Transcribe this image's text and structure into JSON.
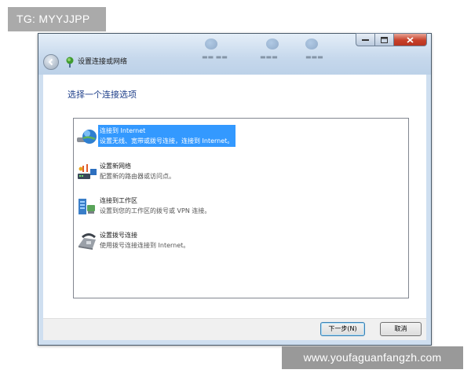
{
  "overlays": {
    "top_left_tag": "TG: MYYJJPP",
    "bottom_right_watermark": "www.youfaguanfangzh.com"
  },
  "window": {
    "title": "设置连接或网络",
    "back_icon": "back-arrow-icon",
    "title_icon": "network-setup-icon",
    "controls": {
      "minimize": "minimize-icon",
      "maximize": "maximize-icon",
      "close": "close-icon"
    }
  },
  "dialog": {
    "heading": "选择一个连接选项",
    "options": [
      {
        "title": "连接到 Internet",
        "desc": "设置无线、宽带或拨号连接，连接到 Internet。",
        "icon": "globe-icon",
        "selected": true
      },
      {
        "title": "设置新网络",
        "desc": "配置新的路由器或访问点。",
        "icon": "router-icon",
        "selected": false
      },
      {
        "title": "连接到工作区",
        "desc": "设置到您的工作区的拨号或 VPN 连接。",
        "icon": "workplace-icon",
        "selected": false
      },
      {
        "title": "设置拨号连接",
        "desc": "使用拨号连接连接到 Internet。",
        "icon": "phone-modem-icon",
        "selected": false
      }
    ]
  },
  "buttons": {
    "next": "下一步(N)",
    "cancel": "取消"
  },
  "colors": {
    "selection": "#3399ff",
    "heading_text": "#1e3f8a",
    "title_bar": "#c6d8ec",
    "close_button": "#c7402a"
  }
}
